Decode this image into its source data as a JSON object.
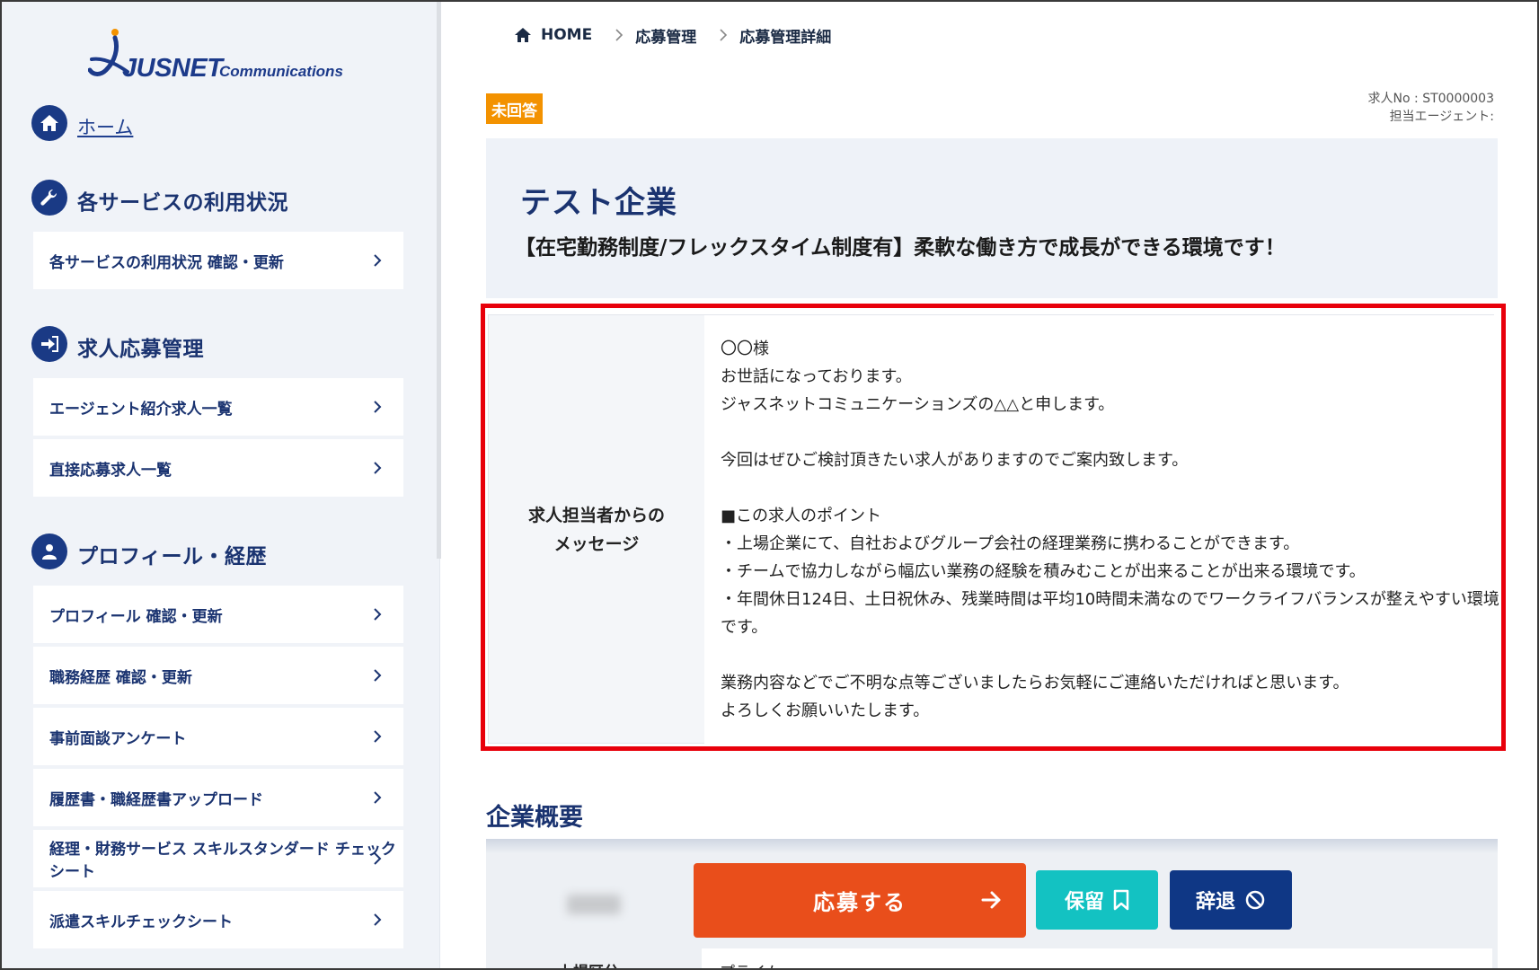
{
  "logo": {
    "main": "JUSNET",
    "sub": "Communications"
  },
  "sidebar": {
    "home_label": "ホーム",
    "sections": [
      {
        "title": "各サービスの利用状況",
        "items": [
          "各サービスの利用状況 確認・更新"
        ]
      },
      {
        "title": "求人応募管理",
        "items": [
          "エージェント紹介求人一覧",
          "直接応募求人一覧"
        ]
      },
      {
        "title": "プロフィール・経歴",
        "items": [
          "プロフィール 確認・更新",
          "職務経歴 確認・更新",
          "事前面談アンケート",
          "履歴書・職経歴書アップロード",
          "経理・財務サービス スキルスタンダード チェックシート",
          "派遣スキルチェックシート"
        ]
      }
    ]
  },
  "breadcrumb": [
    "HOME",
    "応募管理",
    "応募管理詳細"
  ],
  "status_badge": "未回答",
  "job": {
    "job_no": "求人No : ST0000003",
    "agent": "担当エージェント:",
    "company_name": "テスト企業",
    "catch": "【在宅勤務制度/フレックスタイム制度有】柔軟な働き方で成長ができる環境です！"
  },
  "message": {
    "label_line1": "求人担当者からの",
    "label_line2": "メッセージ",
    "lines": [
      "〇〇様",
      "お世話になっております。",
      "ジャスネットコミュニケーションズの△△と申します。",
      "",
      "今回はぜひご検討頂きたい求人がありますのでご案内致します。",
      "",
      "■この求人のポイント",
      "・上場企業にて、自社およびグループ会社の経理業務に携わることができます。",
      "・チームで協力しながら幅広い業務の経験を積みむことが出来ることが出来る環境です。",
      "・年間休日124日、土日祝休み、残業時間は平均10時間未満なのでワークライフバランスが整えやすい環境",
      "です。",
      "",
      "業務内容などでご不明な点等ございましたらお気軽にご連絡いただければと思います。",
      "よろしくお願いいたします。"
    ]
  },
  "overview": {
    "heading": "企業概要",
    "row_label": "上場区分",
    "row_value": "プライム"
  },
  "actions": {
    "apply": "応募する",
    "hold": "保留",
    "decline": "辞退"
  },
  "colors": {
    "navy": "#1a3370",
    "badge_orange": "#f39200",
    "apply_orange": "#e94e1b",
    "hold_teal": "#13c2c2",
    "decline_navy": "#0f3785",
    "highlight_red": "#e8000b"
  }
}
